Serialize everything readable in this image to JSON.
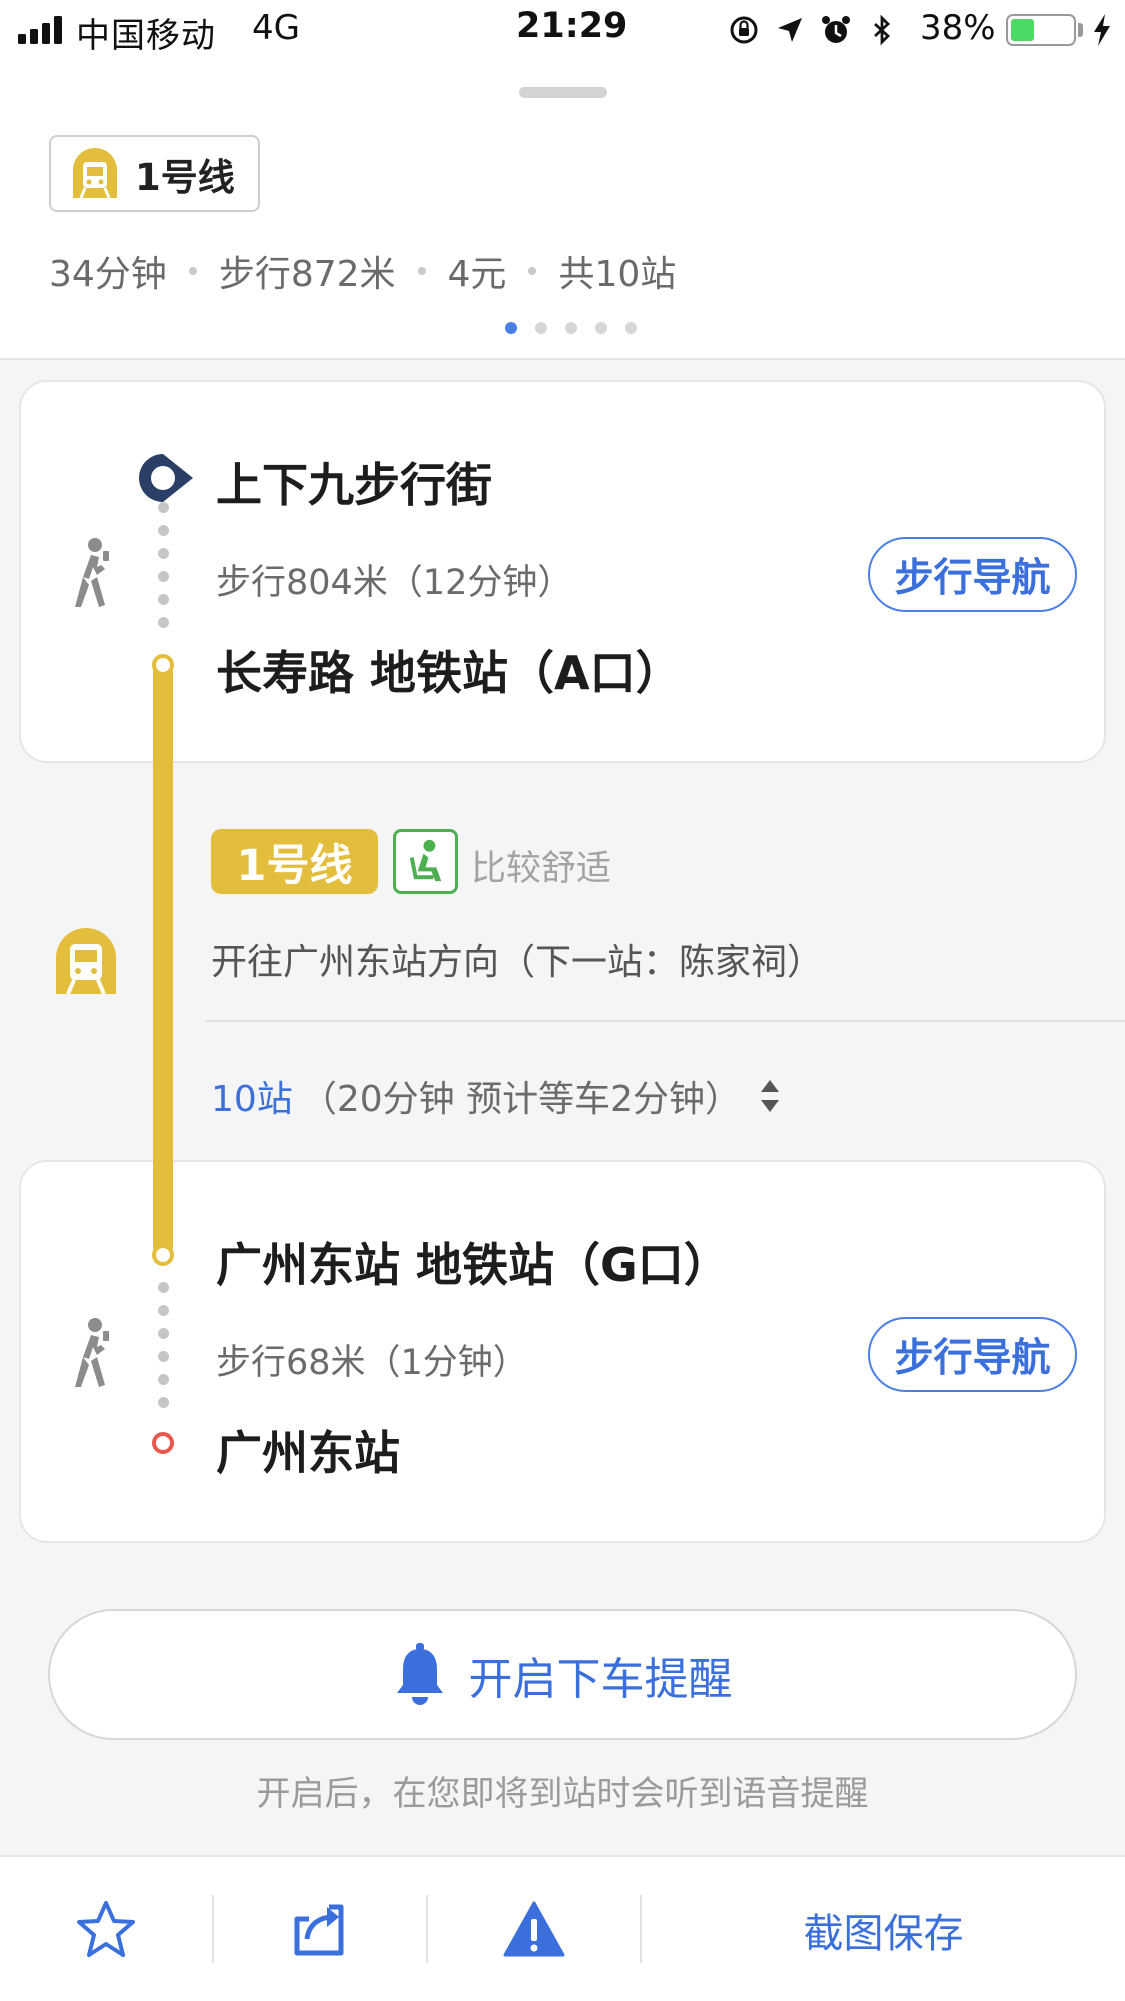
{
  "status_bar": {
    "carrier": "中国移动",
    "network": "4G",
    "time": "21:29",
    "battery_percent": "38%",
    "battery_level": 0.38,
    "icons": [
      "signal-icon",
      "orientation-lock-icon",
      "location-arrow-icon",
      "alarm-icon",
      "bluetooth-icon",
      "battery-icon",
      "charging-icon"
    ]
  },
  "header": {
    "line_chip_label": "1号线",
    "summary": {
      "duration": "34分钟",
      "walk": "步行872米",
      "fare": "4元",
      "stops": "共10站"
    },
    "pager": {
      "count": 5,
      "active_index": 0
    }
  },
  "segment_walk_start": {
    "from": "上下九步行街",
    "walk_info": "步行804米（12分钟）",
    "nav_button": "步行导航",
    "to": "长寿路 地铁站（A口）"
  },
  "segment_metro": {
    "line_badge": "1号线",
    "comfort": "比较舒适",
    "direction": "开往广州东站方向（下一站：陈家祠）",
    "stops_count": "10站",
    "stops_detail": "（20分钟 预计等车2分钟）"
  },
  "segment_walk_end": {
    "from": "广州东站 地铁站（G口）",
    "walk_info": "步行68米（1分钟）",
    "nav_button": "步行导航",
    "to": "广州东站"
  },
  "reminder": {
    "button_label": "开启下车提醒",
    "hint": "开启后，在您即将到站时会听到语音提醒"
  },
  "bottom_bar": {
    "save_label": "截图保存",
    "icons": [
      "star-icon",
      "share-icon",
      "warning-icon"
    ]
  },
  "colors": {
    "accent_blue": "#3a6fdc",
    "metro_yellow": "#e3bd3c",
    "comfort_green": "#4caf50",
    "end_red": "#e6574d"
  }
}
